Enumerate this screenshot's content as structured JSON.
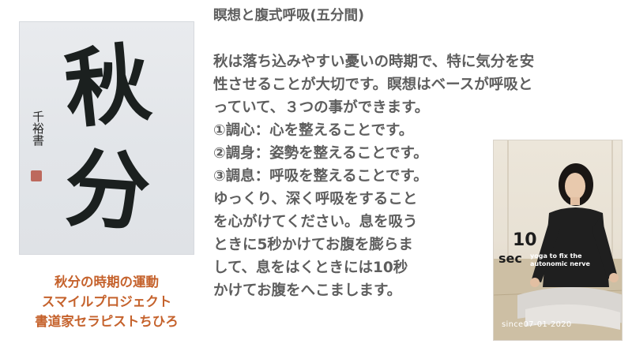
{
  "calligraphy": {
    "char_top": "秋",
    "char_bottom": "分",
    "signature": "千裕書"
  },
  "caption": {
    "lines": [
      "秋分の時期の運動",
      "スマイルプロジェクト",
      "書道家セラピストちひろ"
    ]
  },
  "article": {
    "heading": "瞑想と腹式呼吸(五分間)",
    "lines": [
      "秋は落ち込みやすい憂いの時期で、特に気分を安",
      "性させることが大切です。瞑想はベースが呼吸と",
      "っていて、３つの事ができます。",
      "①調心：心を整えることです。",
      "②調身：姿勢を整えることです。",
      "③調息：呼吸を整えることです。",
      "ゆっくり、深く呼吸をすること",
      "を心がけてください。息を吸う",
      "ときに5秒かけてお腹を膨らま",
      "して、息をはくときには10秒",
      "かけてお腹をへこまします。"
    ]
  },
  "photo": {
    "number": "10",
    "unit": "sec",
    "tagline": [
      "yoga to fix the",
      "autonomic nerve"
    ],
    "since": "since07-01-2020"
  },
  "colors": {
    "caption": "#c5622c",
    "body_text": "#5e5e5e",
    "ink": "#1b201f"
  }
}
